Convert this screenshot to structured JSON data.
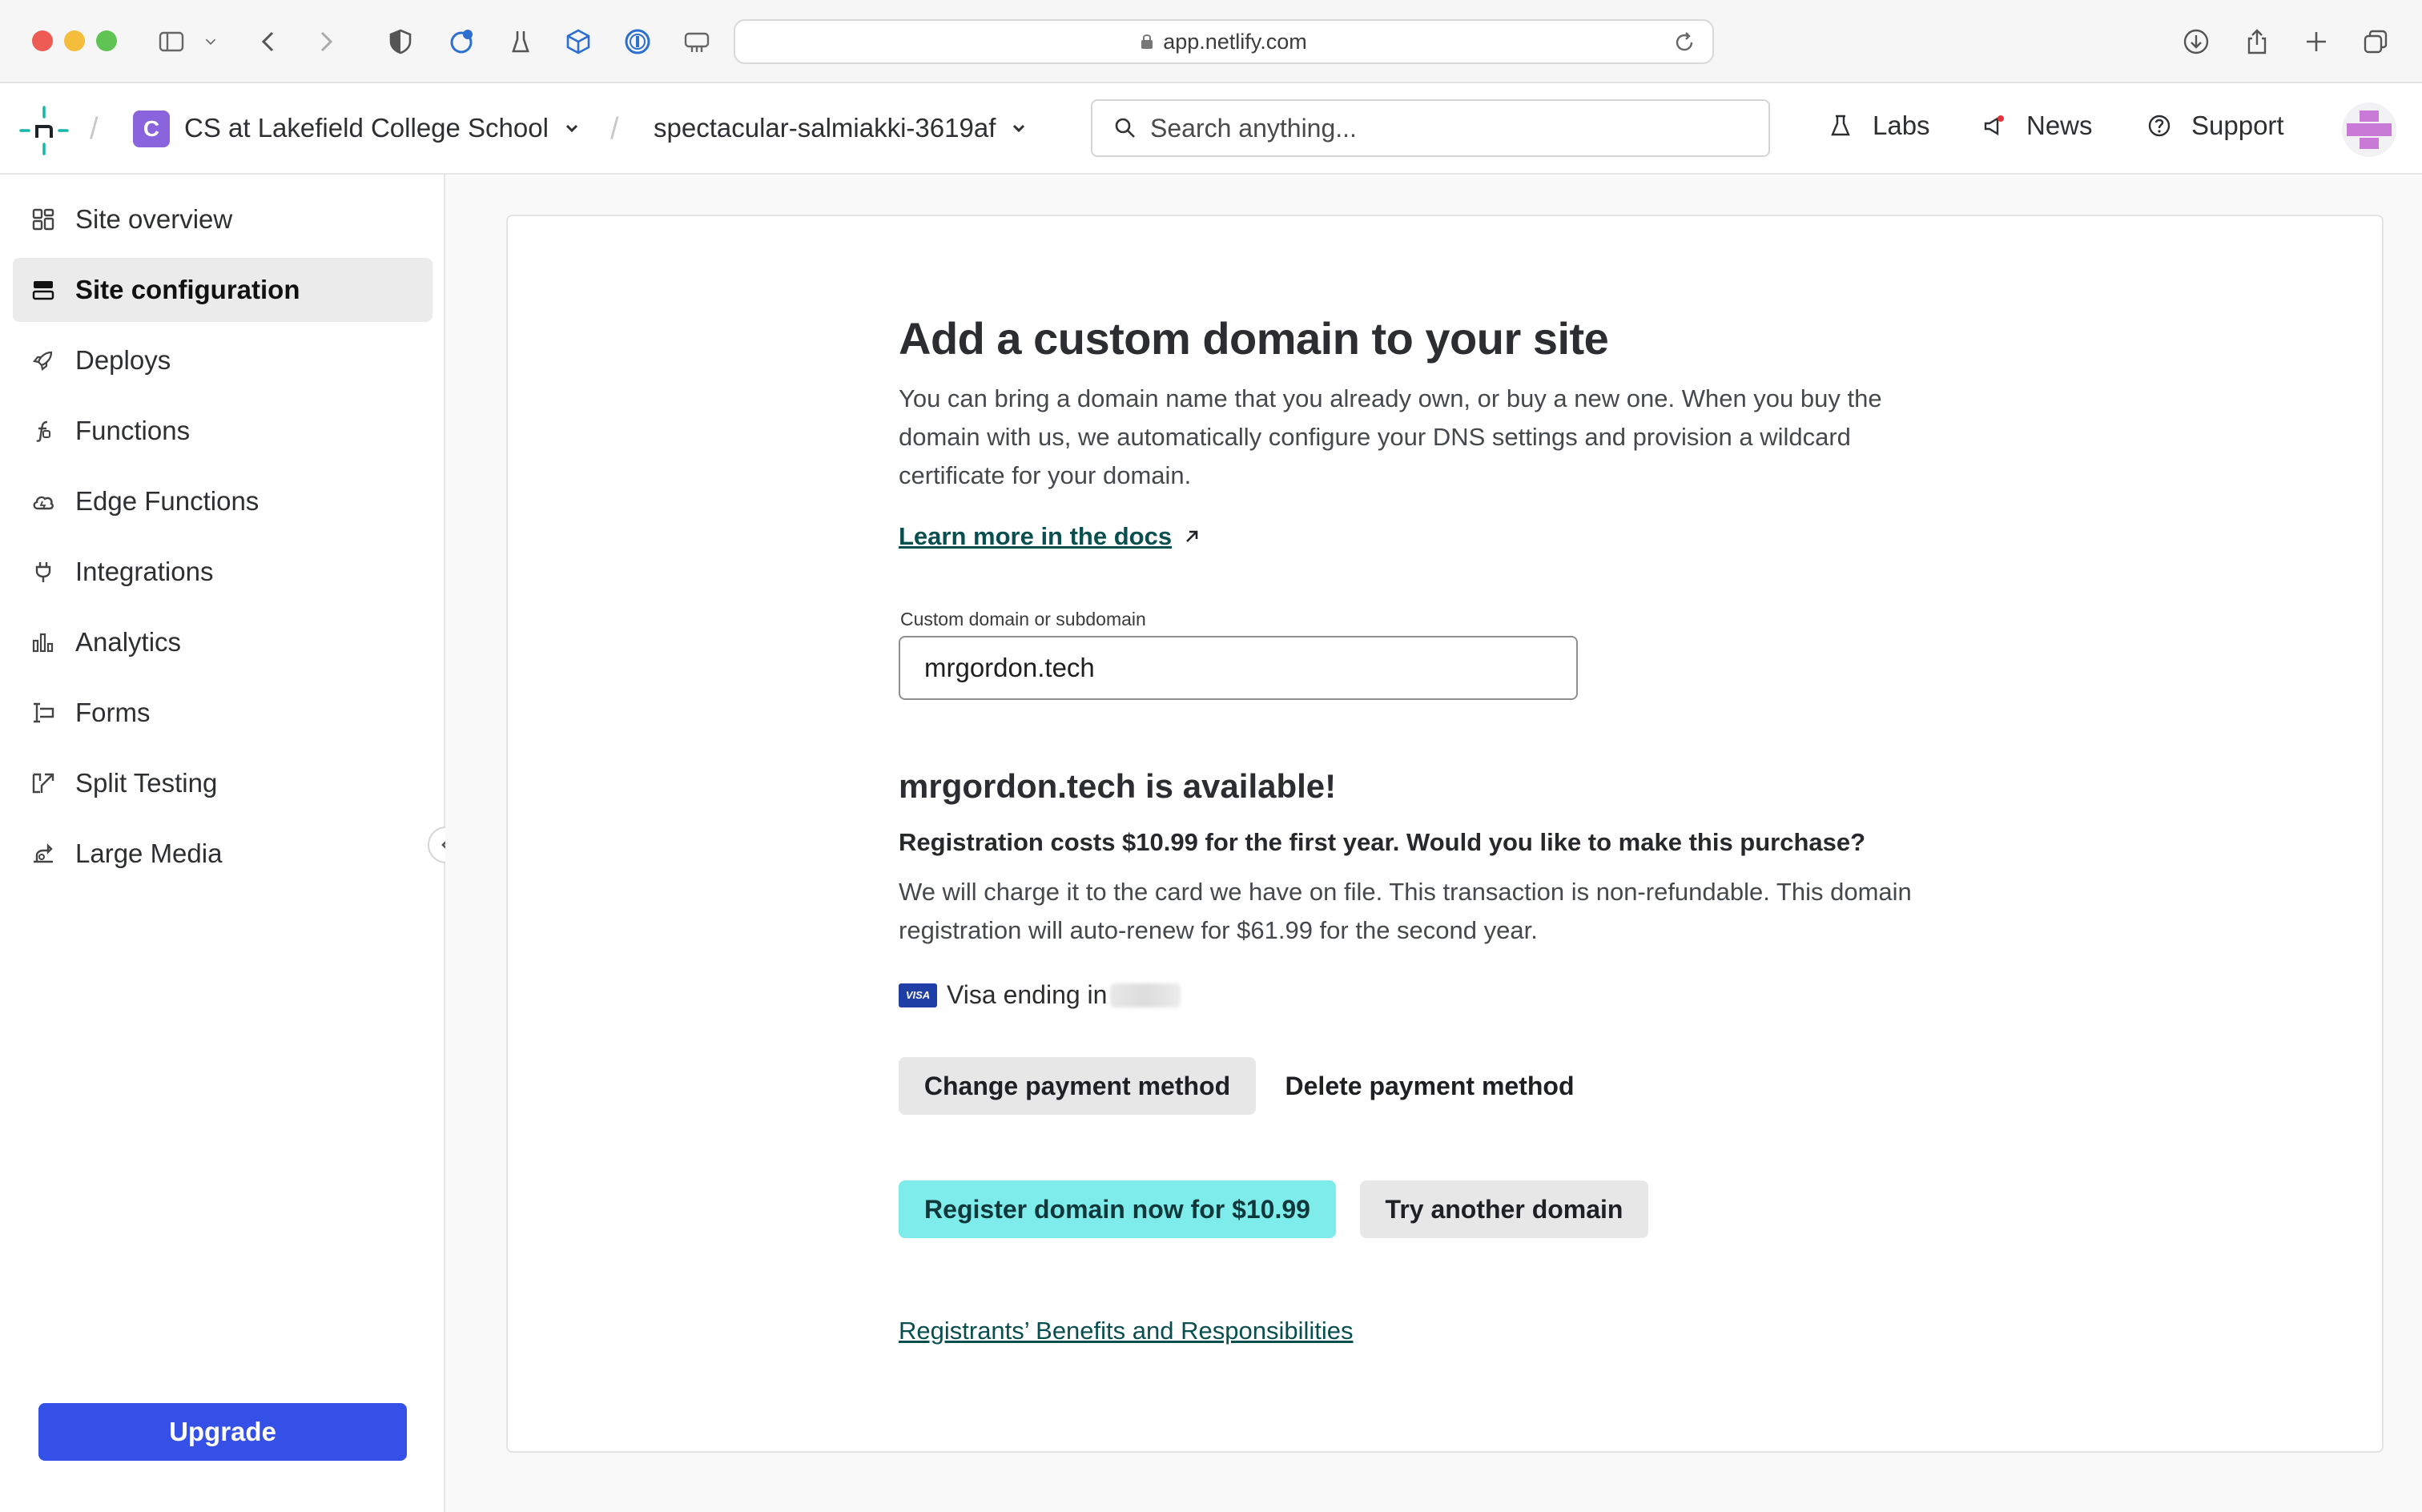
{
  "browser": {
    "url": "app.netlify.com"
  },
  "header": {
    "team_badge": "C",
    "team_name": "CS at Lakefield College School",
    "site_name": "spectacular-salmiakki-3619af",
    "search_placeholder": "Search anything...",
    "nav": {
      "labs": "Labs",
      "news": "News",
      "support": "Support"
    }
  },
  "sidebar": {
    "items": [
      {
        "label": "Site overview",
        "icon": "grid-icon"
      },
      {
        "label": "Site configuration",
        "icon": "server-icon",
        "active": true
      },
      {
        "label": "Deploys",
        "icon": "rocket-icon"
      },
      {
        "label": "Functions",
        "icon": "function-icon"
      },
      {
        "label": "Edge Functions",
        "icon": "cloud-icon"
      },
      {
        "label": "Integrations",
        "icon": "plug-icon"
      },
      {
        "label": "Analytics",
        "icon": "bar-chart-icon"
      },
      {
        "label": "Forms",
        "icon": "form-icon"
      },
      {
        "label": "Split Testing",
        "icon": "split-icon"
      },
      {
        "label": "Large Media",
        "icon": "media-icon"
      }
    ],
    "upgrade_label": "Upgrade"
  },
  "main": {
    "title": "Add a custom domain to your site",
    "intro": "You can bring a domain name that you already own, or buy a new one. When you buy the domain with us, we automatically configure your DNS settings and provision a wildcard certificate for your domain.",
    "learn_more": "Learn more in the docs",
    "field_label": "Custom domain or subdomain",
    "field_value": "mrgordon.tech",
    "available_heading": "mrgordon.tech is available!",
    "cost_text": "Registration costs $10.99 for the first year. Would you like to make this purchase?",
    "charge_text": "We will charge it to the card we have on file. This transaction is non-refundable. This domain registration will auto-renew for $61.99 for the second year.",
    "card_brand": "VISA",
    "card_text": "Visa ending in",
    "change_payment": "Change payment method",
    "delete_payment": "Delete payment method",
    "register_button": "Register domain now for $10.99",
    "try_another": "Try another domain",
    "terms_link": "Registrants’ Benefits and Responsibilities"
  },
  "colors": {
    "accent_teal": "#7eeceb",
    "upgrade_blue": "#3550e6",
    "link": "#0a4f4f",
    "team_badge": "#8a64dc"
  }
}
